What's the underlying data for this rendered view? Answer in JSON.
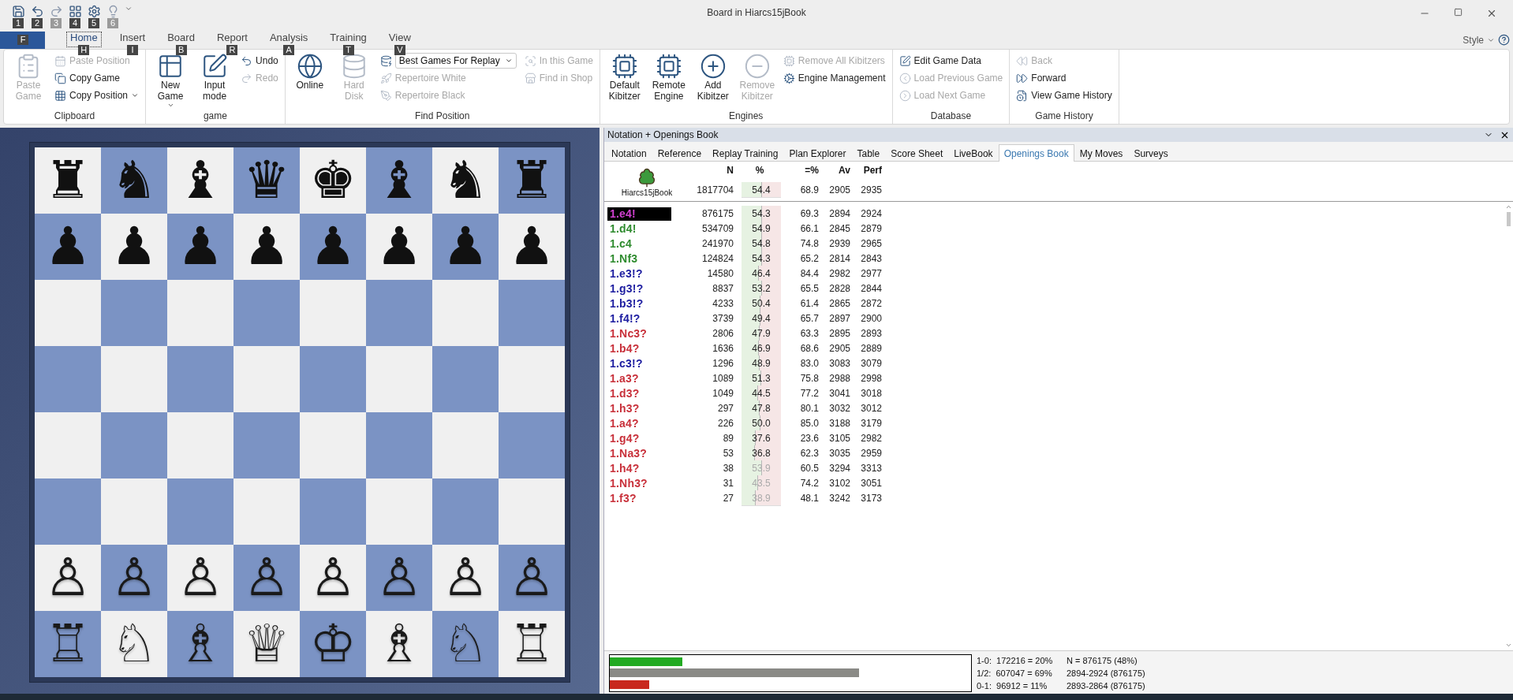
{
  "window": {
    "title": "Board in Hiarcs15jBook"
  },
  "quick_access": [
    {
      "key": "1",
      "disabled": false
    },
    {
      "key": "2",
      "disabled": false
    },
    {
      "key": "3",
      "disabled": true
    },
    {
      "key": "4",
      "disabled": false
    },
    {
      "key": "5",
      "disabled": false
    },
    {
      "key": "6",
      "disabled": true
    }
  ],
  "file_button": {
    "key": "F"
  },
  "ribbon_tabs": [
    {
      "label": "Home",
      "key": "H",
      "selected": true
    },
    {
      "label": "Insert",
      "key": "I",
      "selected": false
    },
    {
      "label": "Board",
      "key": "B",
      "selected": false
    },
    {
      "label": "Report",
      "key": "R",
      "selected": false
    },
    {
      "label": "Analysis",
      "key": "A",
      "selected": false
    },
    {
      "label": "Training",
      "key": "T",
      "selected": false
    },
    {
      "label": "View",
      "key": "V",
      "selected": false
    }
  ],
  "style_menu": "Style",
  "ribbon_groups": [
    {
      "title": "Clipboard",
      "columns": [
        [
          {
            "label": "Paste Game",
            "kind": "large",
            "disabled": true
          }
        ],
        [
          {
            "label": "Paste Position",
            "kind": "small",
            "disabled": true
          },
          {
            "label": "Copy Game",
            "kind": "small",
            "disabled": false
          },
          {
            "label": "Copy Position",
            "kind": "small",
            "disabled": false,
            "has_menu": true
          }
        ]
      ]
    },
    {
      "title": "game",
      "columns": [
        [
          {
            "label": "New Game",
            "kind": "large",
            "disabled": false,
            "has_menu": true
          }
        ],
        [
          {
            "label": "Input mode",
            "kind": "large",
            "disabled": false
          }
        ],
        [
          {
            "label": "Undo",
            "kind": "small",
            "disabled": false
          },
          {
            "label": "Redo",
            "kind": "small",
            "disabled": true
          }
        ]
      ]
    },
    {
      "title": "Find Position",
      "columns": [
        [
          {
            "label": "Online",
            "kind": "large",
            "disabled": false
          }
        ],
        [
          {
            "label": "Hard Disk",
            "kind": "large",
            "disabled": true
          }
        ],
        [
          {
            "label": "Best Games For Replay",
            "kind": "dropdown",
            "disabled": false
          },
          {
            "label": "Repertoire White",
            "kind": "small",
            "disabled": true
          },
          {
            "label": "Repertoire Black",
            "kind": "small",
            "disabled": true
          }
        ],
        [
          {
            "label": "In this Game",
            "kind": "small",
            "disabled": true
          },
          {
            "label": "Find in Shop",
            "kind": "small",
            "disabled": true
          }
        ]
      ]
    },
    {
      "title": "Engines",
      "columns": [
        [
          {
            "label": "Default Kibitzer",
            "kind": "large",
            "disabled": false
          }
        ],
        [
          {
            "label": "Remote Engine",
            "kind": "large",
            "disabled": false
          }
        ],
        [
          {
            "label": "Add Kibitzer",
            "kind": "large",
            "disabled": false
          }
        ],
        [
          {
            "label": "Remove Kibitzer",
            "kind": "large",
            "disabled": true
          }
        ],
        [
          {
            "label": "Remove All Kibitzers",
            "kind": "small",
            "disabled": true
          },
          {
            "label": "Engine Management",
            "kind": "small",
            "disabled": false
          }
        ]
      ]
    },
    {
      "title": "Database",
      "columns": [
        [
          {
            "label": "Edit Game Data",
            "kind": "small",
            "disabled": false
          },
          {
            "label": "Load Previous Game",
            "kind": "small",
            "disabled": true
          },
          {
            "label": "Load Next Game",
            "kind": "small",
            "disabled": true
          }
        ]
      ]
    },
    {
      "title": "Game History",
      "columns": [
        [
          {
            "label": "Back",
            "kind": "small",
            "disabled": true
          },
          {
            "label": "Forward",
            "kind": "small",
            "disabled": false
          },
          {
            "label": "View Game History",
            "kind": "small",
            "disabled": false
          }
        ]
      ]
    }
  ],
  "board": {
    "top_ranks": [
      [
        "♜",
        "♞",
        "♝",
        "♛",
        "♚",
        "♝",
        "♞",
        "♜"
      ],
      [
        "♟",
        "♟",
        "♟",
        "♟",
        "♟",
        "♟",
        "♟",
        "♟"
      ]
    ],
    "bottom_ranks": [
      [
        "♙",
        "♙",
        "♙",
        "♙",
        "♙",
        "♙",
        "♙",
        "♙"
      ],
      [
        "♖",
        "♘",
        "♗",
        "♕",
        "♔",
        "♗",
        "♘",
        "♖"
      ]
    ]
  },
  "panel": {
    "title": "Notation + Openings Book",
    "tabs": [
      {
        "label": "Notation",
        "selected": false
      },
      {
        "label": "Reference",
        "selected": false
      },
      {
        "label": "Replay Training",
        "selected": false
      },
      {
        "label": "Plan Explorer",
        "selected": false
      },
      {
        "label": "Table",
        "selected": false
      },
      {
        "label": "Score Sheet",
        "selected": false
      },
      {
        "label": "LiveBook",
        "selected": false
      },
      {
        "label": "Openings Book",
        "selected": true
      },
      {
        "label": "My Moves",
        "selected": false
      },
      {
        "label": "Surveys",
        "selected": false
      }
    ],
    "book": {
      "name": "Hiarcs15jBook",
      "columns": [
        "N",
        "%",
        "=%",
        "Av",
        "Perf"
      ],
      "totals": {
        "n": "1817704",
        "pct": "54.4",
        "level": 0.544,
        "draw": "68.9",
        "av": "2905",
        "perf": "2935"
      },
      "rows": [
        {
          "move": "1.e4!",
          "selected": true,
          "faded": false,
          "n": "876175",
          "pct": "54.3",
          "level": 0.543,
          "draw": "69.3",
          "av": "2894",
          "perf": "2924"
        },
        {
          "move": "1.d4!",
          "color": "#2e8b2e",
          "selected": false,
          "faded": false,
          "n": "534709",
          "pct": "54.9",
          "level": 0.549,
          "draw": "66.1",
          "av": "2845",
          "perf": "2879"
        },
        {
          "move": "1.c4",
          "color": "#2e8b2e",
          "selected": false,
          "faded": false,
          "n": "241970",
          "pct": "54.8",
          "level": 0.548,
          "draw": "74.8",
          "av": "2939",
          "perf": "2965"
        },
        {
          "move": "1.Nf3",
          "color": "#2e8b2e",
          "selected": false,
          "faded": false,
          "n": "124824",
          "pct": "54.3",
          "level": 0.543,
          "draw": "65.2",
          "av": "2814",
          "perf": "2843"
        },
        {
          "move": "1.e3!?",
          "color": "#1c1ca0",
          "selected": false,
          "faded": false,
          "n": "14580",
          "pct": "46.4",
          "level": 0.464,
          "draw": "84.4",
          "av": "2982",
          "perf": "2977"
        },
        {
          "move": "1.g3!?",
          "color": "#1c1ca0",
          "selected": false,
          "faded": false,
          "n": "8837",
          "pct": "53.2",
          "level": 0.532,
          "draw": "65.5",
          "av": "2828",
          "perf": "2844"
        },
        {
          "move": "1.b3!?",
          "color": "#1c1ca0",
          "selected": false,
          "faded": false,
          "n": "4233",
          "pct": "50.4",
          "level": 0.504,
          "draw": "61.4",
          "av": "2865",
          "perf": "2872"
        },
        {
          "move": "1.f4!?",
          "color": "#1c1ca0",
          "selected": false,
          "faded": false,
          "n": "3739",
          "pct": "49.4",
          "level": 0.494,
          "draw": "65.7",
          "av": "2897",
          "perf": "2900"
        },
        {
          "move": "1.Nc3?",
          "color": "#c8303a",
          "selected": false,
          "faded": false,
          "n": "2806",
          "pct": "47.9",
          "level": 0.479,
          "draw": "63.3",
          "av": "2895",
          "perf": "2893"
        },
        {
          "move": "1.b4?",
          "color": "#c8303a",
          "selected": false,
          "faded": false,
          "n": "1636",
          "pct": "46.9",
          "level": 0.469,
          "draw": "68.6",
          "av": "2905",
          "perf": "2889"
        },
        {
          "move": "1.c3!?",
          "color": "#1c1ca0",
          "selected": false,
          "faded": false,
          "n": "1296",
          "pct": "48.9",
          "level": 0.489,
          "draw": "83.0",
          "av": "3083",
          "perf": "3079"
        },
        {
          "move": "1.a3?",
          "color": "#c8303a",
          "selected": false,
          "faded": false,
          "n": "1089",
          "pct": "51.3",
          "level": 0.513,
          "draw": "75.8",
          "av": "2988",
          "perf": "2998"
        },
        {
          "move": "1.d3?",
          "color": "#c8303a",
          "selected": false,
          "faded": false,
          "n": "1049",
          "pct": "44.5",
          "level": 0.445,
          "draw": "77.2",
          "av": "3041",
          "perf": "3018"
        },
        {
          "move": "1.h3?",
          "color": "#c8303a",
          "selected": false,
          "faded": false,
          "n": "297",
          "pct": "47.8",
          "level": 0.478,
          "draw": "80.1",
          "av": "3032",
          "perf": "3012"
        },
        {
          "move": "1.a4?",
          "color": "#c8303a",
          "selected": false,
          "faded": false,
          "n": "226",
          "pct": "50.0",
          "level": 0.5,
          "draw": "85.0",
          "av": "3188",
          "perf": "3179"
        },
        {
          "move": "1.g4?",
          "color": "#c8303a",
          "selected": false,
          "faded": false,
          "n": "89",
          "pct": "37.6",
          "level": 0.376,
          "draw": "23.6",
          "av": "3105",
          "perf": "2982"
        },
        {
          "move": "1.Na3?",
          "color": "#c8303a",
          "selected": false,
          "faded": false,
          "n": "53",
          "pct": "36.8",
          "level": 0.368,
          "draw": "62.3",
          "av": "3035",
          "perf": "2959"
        },
        {
          "move": "1.h4?",
          "color": "#c8303a",
          "selected": false,
          "faded": true,
          "n": "38",
          "pct": "53.9",
          "level": 0.539,
          "draw": "60.5",
          "av": "3294",
          "perf": "3313"
        },
        {
          "move": "1.Nh3?",
          "color": "#c8303a",
          "selected": false,
          "faded": true,
          "n": "31",
          "pct": "43.5",
          "level": 0.435,
          "draw": "74.2",
          "av": "3102",
          "perf": "3051"
        },
        {
          "move": "1.f3?",
          "color": "#c8303a",
          "selected": false,
          "faded": true,
          "n": "27",
          "pct": "38.9",
          "level": 0.389,
          "draw": "48.1",
          "av": "3242",
          "perf": "3173"
        }
      ]
    },
    "results": [
      {
        "label": "1-0:  172216 = 20%",
        "level": 0.2,
        "color": "#22aa22"
      },
      {
        "label": "1/2:  607047 = 69%",
        "level": 0.69,
        "color": "#8a8a86"
      },
      {
        "label": "0-1:  96912 = 11%",
        "level": 0.11,
        "color": "#c8281e"
      }
    ],
    "summary": [
      "N = 876175 (48%)",
      "2894-2924 (876175)",
      "2893-2864 (876175)"
    ]
  }
}
